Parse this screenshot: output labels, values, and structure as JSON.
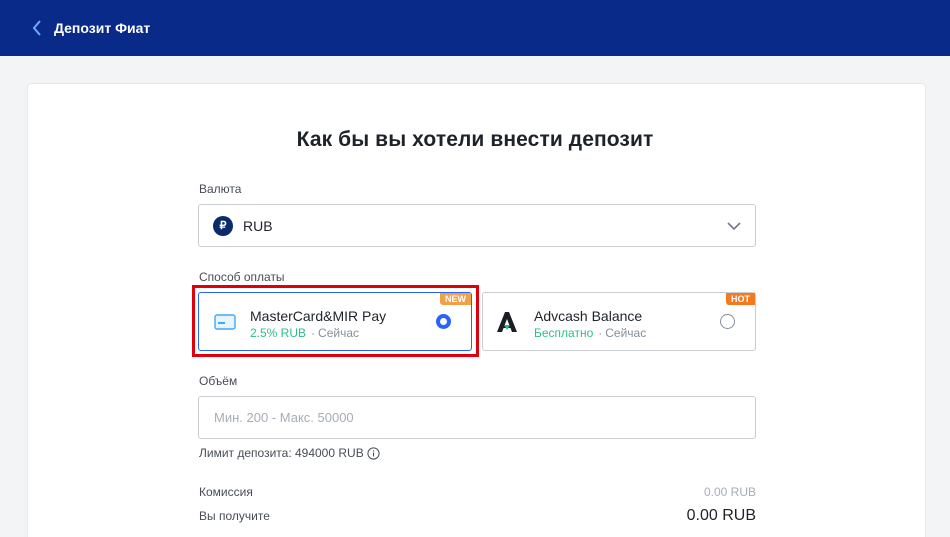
{
  "header": {
    "title": "Депозит Фиат"
  },
  "main": {
    "heading": "Как бы вы хотели внести депозит",
    "currency": {
      "label": "Валюта",
      "symbol": "₽",
      "value": "RUB"
    },
    "payment": {
      "label": "Способ оплаты",
      "methods": [
        {
          "name": "MasterCard&MIR Pay",
          "fee": "2.5% RUB",
          "time": "Сейчас",
          "badge": "NEW",
          "selected": true
        },
        {
          "name": "Advcash Balance",
          "fee": "Бесплатно",
          "time": "Сейчас",
          "badge": "HOT",
          "selected": false
        }
      ]
    },
    "amount": {
      "label": "Объём",
      "placeholder": "Мин. 200 - Макс. 50000",
      "value": ""
    },
    "limit": "Лимит депозита: 494000 RUB",
    "commission": {
      "label": "Комиссия",
      "value": "0.00 RUB"
    },
    "receive": {
      "label": "Вы получите",
      "value": "0.00 RUB"
    }
  },
  "colors": {
    "header_bg": "#0a2a8a",
    "accent": "#2962ff",
    "fee_green": "#2ebd85",
    "highlight": "#e0000b"
  }
}
